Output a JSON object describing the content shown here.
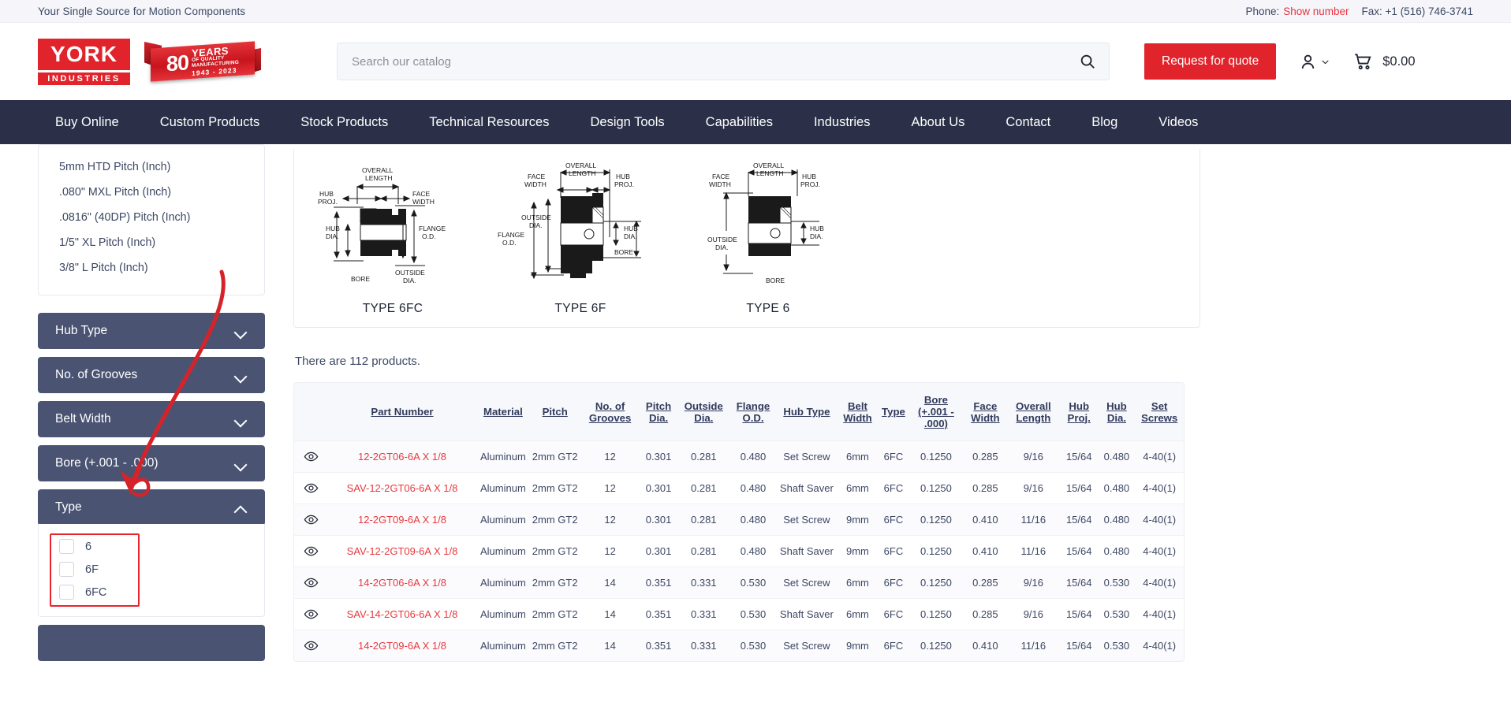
{
  "topbar": {
    "tagline": "Your Single Source for Motion Components",
    "phone_label": "Phone:",
    "phone_link": "Show number",
    "fax": "Fax: +1 (516) 746-3741"
  },
  "header": {
    "logo_main": "YORK",
    "logo_sub": "INDUSTRIES",
    "badge_number": "80",
    "badge_years": "YEARS",
    "badge_line1": "OF QUALITY",
    "badge_line2": "MANUFACTURING",
    "badge_dates": "1943  -  2023",
    "search_placeholder": "Search our catalog",
    "search_value": "",
    "rfq_label": "Request for quote",
    "cart_total": "$0.00"
  },
  "nav": {
    "items": [
      {
        "label": "Buy Online"
      },
      {
        "label": "Custom Products"
      },
      {
        "label": "Stock Products"
      },
      {
        "label": "Technical Resources"
      },
      {
        "label": "Design Tools"
      },
      {
        "label": "Capabilities"
      },
      {
        "label": "Industries"
      },
      {
        "label": "About Us"
      },
      {
        "label": "Contact"
      },
      {
        "label": "Blog"
      },
      {
        "label": "Videos"
      }
    ]
  },
  "sidebar": {
    "pitch_links": [
      {
        "label": "5mm HTD Pitch (Inch)"
      },
      {
        "label": ".080\" MXL Pitch (Inch)"
      },
      {
        "label": ".0816\" (40DP) Pitch (Inch)"
      },
      {
        "label": "1/5\" XL Pitch (Inch)"
      },
      {
        "label": "3/8\" L Pitch (Inch)"
      }
    ],
    "accordions": [
      {
        "label": "Hub Type",
        "state": "collapsed"
      },
      {
        "label": "No. of Grooves",
        "state": "collapsed"
      },
      {
        "label": "Belt Width",
        "state": "collapsed"
      },
      {
        "label": "Bore (+.001 - .000)",
        "state": "collapsed"
      },
      {
        "label": "Type",
        "state": "expanded"
      }
    ],
    "type_options": [
      {
        "label": "6",
        "checked": false
      },
      {
        "label": "6F",
        "checked": false
      },
      {
        "label": "6FC",
        "checked": false
      }
    ],
    "highlight_color": "#e8252c"
  },
  "main": {
    "diagrams": [
      {
        "caption": "TYPE 6FC"
      },
      {
        "caption": "TYPE 6F"
      },
      {
        "caption": "TYPE 6"
      }
    ],
    "diagram_labels": {
      "overall_length": "OVERALL LENGTH",
      "face_width": "FACE WIDTH",
      "hub_proj": "HUB PROJ.",
      "hub_dia": "HUB DIA.",
      "flange_od": "FLANGE O.D.",
      "outside_dia": "OUTSIDE DIA.",
      "bore": "BORE"
    },
    "product_count": "There are 112 products.",
    "table": {
      "columns": [
        "Part Number",
        "Material",
        "Pitch",
        "No. of Grooves",
        "Pitch Dia.",
        "Outside Dia.",
        "Flange O.D.",
        "Hub Type",
        "Belt Width",
        "Type",
        "Bore (+.001 - .000)",
        "Face Width",
        "Overall Length",
        "Hub Proj.",
        "Hub Dia.",
        "Set Screws"
      ],
      "rows": [
        {
          "part": "12-2GT06-6A X 1/8",
          "material": "Aluminum",
          "pitch": "2mm GT2",
          "grooves": "12",
          "pitch_dia": "0.301",
          "outside_dia": "0.281",
          "flange_od": "0.480",
          "hub_type": "Set Screw",
          "belt_width": "6mm",
          "type": "6FC",
          "bore": "0.1250",
          "face_width": "0.285",
          "overall_length": "9/16",
          "hub_proj": "15/64",
          "hub_dia": "0.480",
          "set_screws": "4-40(1)"
        },
        {
          "part": "SAV-12-2GT06-6A X 1/8",
          "material": "Aluminum",
          "pitch": "2mm GT2",
          "grooves": "12",
          "pitch_dia": "0.301",
          "outside_dia": "0.281",
          "flange_od": "0.480",
          "hub_type": "Shaft Saver",
          "belt_width": "6mm",
          "type": "6FC",
          "bore": "0.1250",
          "face_width": "0.285",
          "overall_length": "9/16",
          "hub_proj": "15/64",
          "hub_dia": "0.480",
          "set_screws": "4-40(1)"
        },
        {
          "part": "12-2GT09-6A X 1/8",
          "material": "Aluminum",
          "pitch": "2mm GT2",
          "grooves": "12",
          "pitch_dia": "0.301",
          "outside_dia": "0.281",
          "flange_od": "0.480",
          "hub_type": "Set Screw",
          "belt_width": "9mm",
          "type": "6FC",
          "bore": "0.1250",
          "face_width": "0.410",
          "overall_length": "11/16",
          "hub_proj": "15/64",
          "hub_dia": "0.480",
          "set_screws": "4-40(1)"
        },
        {
          "part": "SAV-12-2GT09-6A X 1/8",
          "material": "Aluminum",
          "pitch": "2mm GT2",
          "grooves": "12",
          "pitch_dia": "0.301",
          "outside_dia": "0.281",
          "flange_od": "0.480",
          "hub_type": "Shaft Saver",
          "belt_width": "9mm",
          "type": "6FC",
          "bore": "0.1250",
          "face_width": "0.410",
          "overall_length": "11/16",
          "hub_proj": "15/64",
          "hub_dia": "0.480",
          "set_screws": "4-40(1)"
        },
        {
          "part": "14-2GT06-6A X 1/8",
          "material": "Aluminum",
          "pitch": "2mm GT2",
          "grooves": "14",
          "pitch_dia": "0.351",
          "outside_dia": "0.331",
          "flange_od": "0.530",
          "hub_type": "Set Screw",
          "belt_width": "6mm",
          "type": "6FC",
          "bore": "0.1250",
          "face_width": "0.285",
          "overall_length": "9/16",
          "hub_proj": "15/64",
          "hub_dia": "0.530",
          "set_screws": "4-40(1)"
        },
        {
          "part": "SAV-14-2GT06-6A X 1/8",
          "material": "Aluminum",
          "pitch": "2mm GT2",
          "grooves": "14",
          "pitch_dia": "0.351",
          "outside_dia": "0.331",
          "flange_od": "0.530",
          "hub_type": "Shaft Saver",
          "belt_width": "6mm",
          "type": "6FC",
          "bore": "0.1250",
          "face_width": "0.285",
          "overall_length": "9/16",
          "hub_proj": "15/64",
          "hub_dia": "0.530",
          "set_screws": "4-40(1)"
        },
        {
          "part": "14-2GT09-6A X 1/8",
          "material": "Aluminum",
          "pitch": "2mm GT2",
          "grooves": "14",
          "pitch_dia": "0.351",
          "outside_dia": "0.331",
          "flange_od": "0.530",
          "hub_type": "Set Screw",
          "belt_width": "9mm",
          "type": "6FC",
          "bore": "0.1250",
          "face_width": "0.410",
          "overall_length": "11/16",
          "hub_proj": "15/64",
          "hub_dia": "0.530",
          "set_screws": "4-40(1)"
        }
      ]
    }
  },
  "colors": {
    "brand_red": "#e1242b",
    "nav_dark": "#2b3048",
    "accordion": "#4a5472",
    "link_red": "#e8383f"
  }
}
